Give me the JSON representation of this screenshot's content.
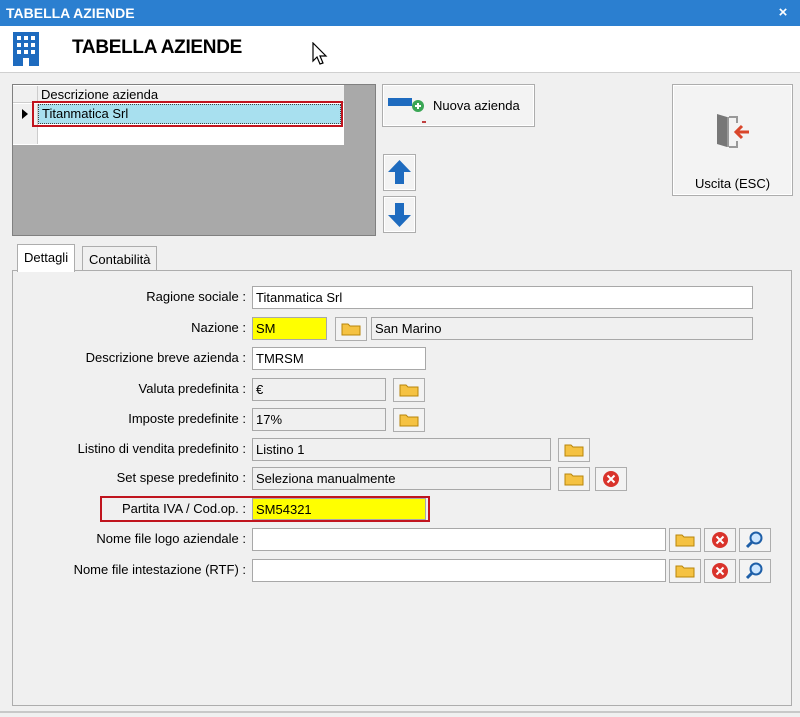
{
  "window": {
    "title": "TABELLA AZIENDE",
    "close": "×"
  },
  "header": {
    "title": "TABELLA AZIENDE"
  },
  "grid": {
    "column_header": "Descrizione azienda",
    "rows": [
      "Titanmatica Srl"
    ]
  },
  "buttons": {
    "new_company": "Nuova azienda",
    "exit": "Uscita (ESC)"
  },
  "tabs": [
    "Dettagli",
    "Contabilità"
  ],
  "form": {
    "ragione_sociale": {
      "label": "Ragione sociale :",
      "value": "Titanmatica Srl"
    },
    "nazione": {
      "label": "Nazione :",
      "code": "SM",
      "name": "San Marino"
    },
    "descr_breve": {
      "label": "Descrizione breve azienda :",
      "value": "TMRSM"
    },
    "valuta": {
      "label": "Valuta predefinita :",
      "value": "€"
    },
    "imposte": {
      "label": "Imposte predefinite :",
      "value": "17%"
    },
    "listino": {
      "label": "Listino di vendita predefinito :",
      "value": "Listino 1"
    },
    "set_spese": {
      "label": "Set spese predefinito :",
      "value": "Seleziona manualmente"
    },
    "partita_iva": {
      "label": "Partita IVA / Cod.op. :",
      "value": "SM54321"
    },
    "file_logo": {
      "label": "Nome file logo aziendale :",
      "value": ""
    },
    "file_intestazione": {
      "label": "Nome file intestazione (RTF) :",
      "value": ""
    }
  },
  "colors": {
    "titlebar": "#2b7fd0",
    "highlight": "#ffff00",
    "selection": "#a8e0ef",
    "annotation": "#c0141e"
  }
}
